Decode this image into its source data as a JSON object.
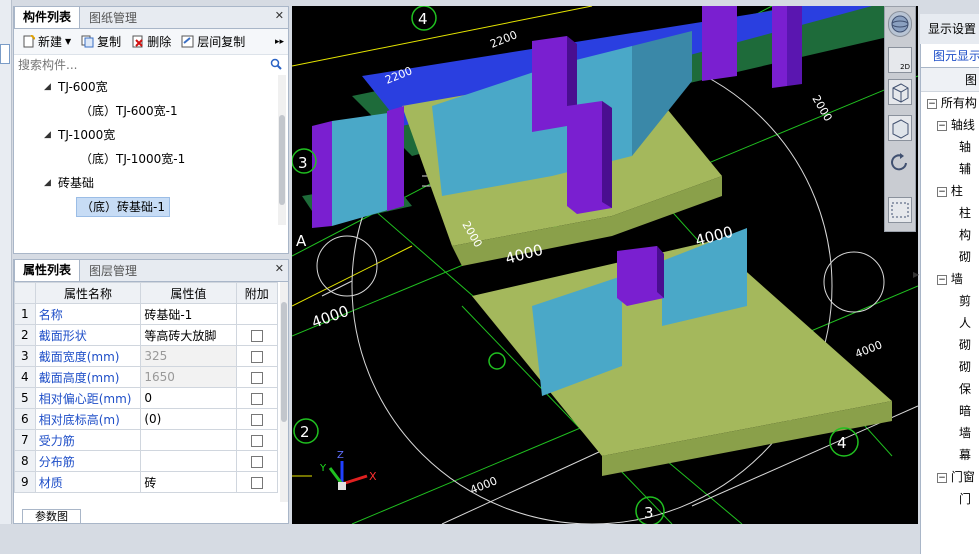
{
  "top_panel": {
    "tabs": [
      "构件列表",
      "图纸管理"
    ],
    "toolbar": {
      "new": "新建",
      "copy": "复制",
      "delete": "删除",
      "floor_copy": "层间复制",
      "more": "▸▸"
    },
    "search_placeholder": "搜索构件...",
    "tree": [
      {
        "label": "TJ-600宽",
        "level": 0,
        "expanded": true
      },
      {
        "label": "（底）TJ-600宽-1",
        "level": 1
      },
      {
        "label": "TJ-1000宽",
        "level": 0,
        "expanded": true
      },
      {
        "label": "（底）TJ-1000宽-1",
        "level": 1
      },
      {
        "label": "砖基础",
        "level": 0,
        "expanded": true
      },
      {
        "label": "（底）砖基础-1",
        "level": 1,
        "selected": true
      }
    ]
  },
  "prop_panel": {
    "tabs": [
      "属性列表",
      "图层管理"
    ],
    "headers": [
      "属性名称",
      "属性值",
      "附加"
    ],
    "rows": [
      {
        "idx": "1",
        "name": "名称",
        "value": "砖基础-1",
        "extra": false,
        "greyed": false
      },
      {
        "idx": "2",
        "name": "截面形状",
        "value": "等高砖大放脚",
        "extra": true,
        "greyed": false
      },
      {
        "idx": "3",
        "name": "截面宽度(mm)",
        "value": "325",
        "extra": true,
        "greyed": true
      },
      {
        "idx": "4",
        "name": "截面高度(mm)",
        "value": "1650",
        "extra": true,
        "greyed": true
      },
      {
        "idx": "5",
        "name": "相对偏心距(mm)",
        "value": "0",
        "extra": true,
        "greyed": false
      },
      {
        "idx": "6",
        "name": "相对底标高(m)",
        "value": "(0)",
        "extra": true,
        "greyed": false
      },
      {
        "idx": "7",
        "name": "受力筋",
        "value": "",
        "extra": true,
        "greyed": false
      },
      {
        "idx": "8",
        "name": "分布筋",
        "value": "",
        "extra": true,
        "greyed": false
      },
      {
        "idx": "9",
        "name": "材质",
        "value": "砖",
        "extra": true,
        "greyed": false
      }
    ],
    "bottom_tab": "参数图"
  },
  "viewport": {
    "axis_labels": [
      "4",
      "3",
      "A",
      "2",
      "3",
      "4",
      "3"
    ],
    "dims": [
      "2200",
      "2200",
      "2200",
      "4000",
      "4000",
      "4000",
      "4000",
      "4000",
      "2000",
      "2000"
    ],
    "axes_letters": [
      "Z",
      "Y",
      "X"
    ]
  },
  "vtool": {
    "btn2d": "2D"
  },
  "right_panel": {
    "title": "显示设置",
    "tab": "图元显示",
    "header": "图",
    "items": [
      {
        "label": "所有构",
        "box": "−",
        "indent": 0
      },
      {
        "label": "轴线",
        "box": "−",
        "indent": 1
      },
      {
        "label": "轴",
        "box": "",
        "indent": 2
      },
      {
        "label": "辅",
        "box": "",
        "indent": 2
      },
      {
        "label": "柱",
        "box": "−",
        "indent": 1
      },
      {
        "label": "柱",
        "box": "",
        "indent": 2
      },
      {
        "label": "构",
        "box": "",
        "indent": 2
      },
      {
        "label": "砌",
        "box": "",
        "indent": 2
      },
      {
        "label": "墙",
        "box": "−",
        "indent": 1
      },
      {
        "label": "剪",
        "box": "",
        "indent": 2
      },
      {
        "label": "人",
        "box": "",
        "indent": 2
      },
      {
        "label": "砌",
        "box": "",
        "indent": 2
      },
      {
        "label": "砌",
        "box": "",
        "indent": 2
      },
      {
        "label": "保",
        "box": "",
        "indent": 2
      },
      {
        "label": "暗",
        "box": "",
        "indent": 2
      },
      {
        "label": "墙",
        "box": "",
        "indent": 2
      },
      {
        "label": "幕",
        "box": "",
        "indent": 2
      },
      {
        "label": "门窗",
        "box": "−",
        "indent": 1
      },
      {
        "label": "门",
        "box": "",
        "indent": 2
      }
    ]
  }
}
